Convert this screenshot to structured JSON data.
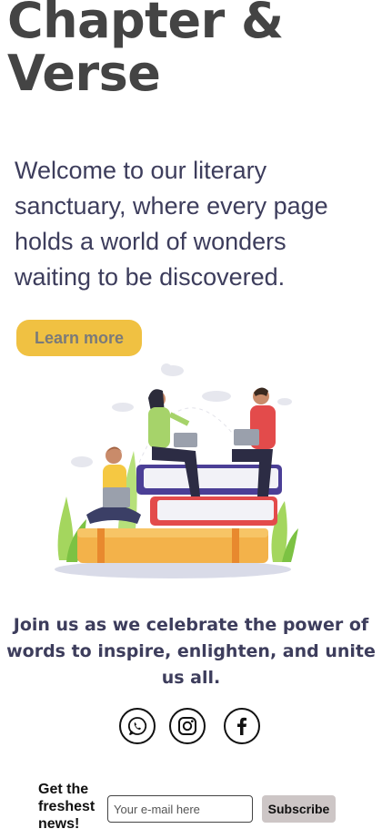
{
  "header": {
    "title": "Chapter & Verse"
  },
  "hero": {
    "intro": "Welcome to our literary sanctuary, where every page holds a world of wonders waiting to be discovered.",
    "cta_label": "Learn more",
    "illustration_icon": "people-reading-on-books-illustration"
  },
  "tagline": "Join us as we celebrate the power of words to inspire, enlighten, and unite us all.",
  "socials": [
    {
      "name": "whatsapp",
      "icon": "whatsapp-icon"
    },
    {
      "name": "instagram",
      "icon": "instagram-icon"
    },
    {
      "name": "facebook",
      "icon": "facebook-icon"
    }
  ],
  "newsletter": {
    "label": "Get the freshest news!",
    "email_placeholder": "Your e-mail here",
    "email_value": "",
    "subscribe_label": "Subscribe"
  },
  "colors": {
    "accent": "#f0c142",
    "heading": "#444444",
    "text": "#3d3d5c",
    "subscribe_bg": "#cdc6c6"
  }
}
